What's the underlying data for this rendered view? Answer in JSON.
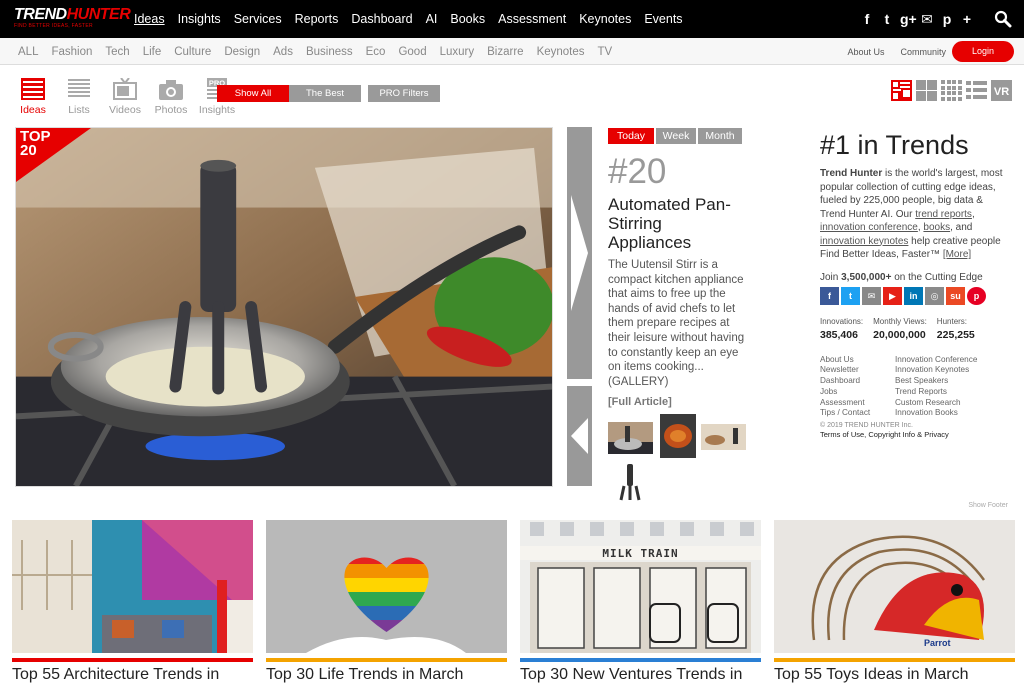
{
  "brand": {
    "name_part1": "TREND",
    "name_part2": "HUNTER",
    "tagline": "FIND BETTER IDEAS, FASTER"
  },
  "main_nav": [
    "Ideas",
    "Insights",
    "Services",
    "Reports",
    "Dashboard",
    "AI",
    "Books",
    "Assessment",
    "Keynotes",
    "Events"
  ],
  "social_top": [
    {
      "icon": "facebook-icon",
      "glyph": "f"
    },
    {
      "icon": "twitter-icon",
      "glyph": "t"
    },
    {
      "icon": "google-plus-icon",
      "glyph": "g+"
    },
    {
      "icon": "email-icon",
      "glyph": "✉"
    },
    {
      "icon": "pinterest-icon",
      "glyph": "p"
    },
    {
      "icon": "plus-icon",
      "glyph": "+"
    }
  ],
  "categories": [
    "ALL",
    "Fashion",
    "Tech",
    "Life",
    "Culture",
    "Design",
    "Ads",
    "Business",
    "Eco",
    "Good",
    "Luxury",
    "Bizarre",
    "Keynotes",
    "TV"
  ],
  "right_links": {
    "about": "About Us",
    "community": "Community",
    "login": "Login"
  },
  "types": [
    {
      "label": "Ideas",
      "icon": "ideas-icon",
      "active": true
    },
    {
      "label": "Lists",
      "icon": "lists-icon",
      "active": false
    },
    {
      "label": "Videos",
      "icon": "videos-icon",
      "active": false
    },
    {
      "label": "Photos",
      "icon": "photos-icon",
      "active": false
    },
    {
      "label": "Insights",
      "icon": "insights-icon",
      "active": false,
      "badge": "PRO"
    }
  ],
  "filters": [
    {
      "label": "Show All",
      "active": true
    },
    {
      "label": "The Best",
      "active": false
    },
    {
      "label": "PRO Filters",
      "active": false
    }
  ],
  "view_options": {
    "vr_label": "VR"
  },
  "hero": {
    "badge_line1": "TOP",
    "badge_line2": "20"
  },
  "periods": [
    {
      "label": "Today",
      "active": true
    },
    {
      "label": "Week",
      "active": false
    },
    {
      "label": "Month",
      "active": false
    }
  ],
  "article": {
    "rank": "#20",
    "title": "Automated Pan-Stirring Appliances",
    "description": "The Uutensil Stirr is a compact kitchen appliance that aims to free up the hands of avid chefs to let them prepare recipes at their leisure without having to constantly keep an eye on items cooking... (GALLERY)",
    "full_article": "[Full Article]"
  },
  "sidebar": {
    "heading": "#1 in Trends",
    "about_brand": "Trend Hunter",
    "about_text1": " is the world's largest, most popular collection of cutting edge ideas, fueled by 225,000 people, big data & Trend Hunter AI. Our ",
    "link_reports": "trend reports",
    "sep1": ", ",
    "link_conference": "innovation conference",
    "sep2": ", ",
    "link_books": "books",
    "sep3": ", and ",
    "link_keynotes": "innovation keynotes",
    "about_text2": " help creative people Find Better Ideas, Faster™ ",
    "link_more": "[More]",
    "join_prefix": "Join ",
    "join_count": "3,500,000+",
    "join_suffix": " on the Cutting Edge",
    "social": [
      {
        "icon": "facebook-icon",
        "glyph": "f",
        "color": "#3b5998"
      },
      {
        "icon": "twitter-icon",
        "glyph": "t",
        "color": "#1da1f2"
      },
      {
        "icon": "email-icon",
        "glyph": "✉",
        "color": "#888888"
      },
      {
        "icon": "youtube-icon",
        "glyph": "▶",
        "color": "#e62117"
      },
      {
        "icon": "linkedin-icon",
        "glyph": "in",
        "color": "#0077b5"
      },
      {
        "icon": "instagram-icon",
        "glyph": "◎",
        "color": "#8a8a8a"
      },
      {
        "icon": "stumbleupon-icon",
        "glyph": "su",
        "color": "#eb4924"
      },
      {
        "icon": "pinterest-icon",
        "glyph": "p",
        "color": "#e60023"
      }
    ],
    "stats": [
      {
        "label": "Innovations:",
        "value": "385,406"
      },
      {
        "label": "Monthly Views:",
        "value": "20,000,000"
      },
      {
        "label": "Hunters:",
        "value": "225,255"
      }
    ],
    "links_col1": [
      "About Us",
      "Newsletter",
      "Dashboard",
      "Jobs",
      "Assessment",
      "Tips / Contact"
    ],
    "links_col2": [
      "Innovation Conference",
      "Innovation Keynotes",
      "Best Speakers",
      "Trend Reports",
      "Custom Research",
      "Innovation Books"
    ],
    "copyright": "© 2019 TREND HUNTER Inc.",
    "terms": "Terms of Use, Copyright Info & Privacy",
    "show_footer": "Show Footer"
  },
  "cards": [
    {
      "title": "Top 55 Architecture Trends in",
      "bar_color": "#e60000"
    },
    {
      "title": "Top 30 Life Trends in March",
      "bar_color": "#f4a300"
    },
    {
      "title": "Top 30 New Ventures Trends in",
      "bar_color": "#2a7fd4"
    },
    {
      "title": "Top 55 Toys Ideas in March",
      "bar_color": "#f4a300"
    }
  ]
}
